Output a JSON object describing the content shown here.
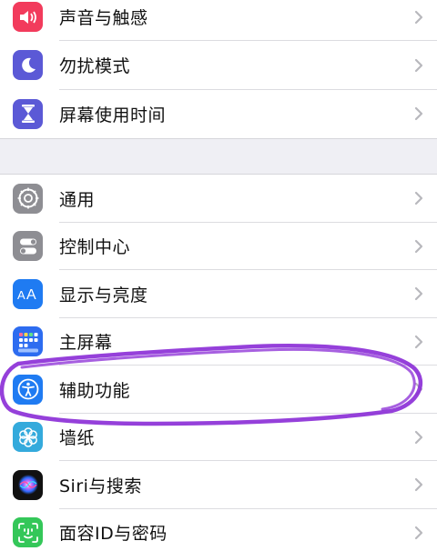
{
  "colors": {
    "sounds": "#f23b5c",
    "focus": "#5b59d6",
    "screen_time": "#5b59d6",
    "general": "#8e8e93",
    "control_center": "#8e8e93",
    "display": "#1f7bf2",
    "home_screen": "#2d6cf0",
    "accessibility": "#1f7bf2",
    "wallpaper": "#34aadc",
    "siri": "#111111",
    "faceid": "#34c759",
    "annotation": "#8a2bd6"
  },
  "settings": {
    "group1": [
      {
        "label": "声音与触感",
        "icon": "speaker-icon"
      },
      {
        "label": "勿扰模式",
        "icon": "moon-icon"
      },
      {
        "label": "屏幕使用时间",
        "icon": "hourglass-icon"
      }
    ],
    "group2": [
      {
        "label": "通用",
        "icon": "gear-icon"
      },
      {
        "label": "控制中心",
        "icon": "toggles-icon"
      },
      {
        "label": "显示与亮度",
        "icon": "text-size-icon"
      },
      {
        "label": "主屏幕",
        "icon": "home-grid-icon"
      },
      {
        "label": "辅助功能",
        "icon": "accessibility-icon"
      },
      {
        "label": "墙纸",
        "icon": "flower-icon"
      },
      {
        "label": "Siri与搜索",
        "icon": "siri-icon"
      },
      {
        "label": "面容ID与密码",
        "icon": "face-id-icon"
      }
    ]
  }
}
